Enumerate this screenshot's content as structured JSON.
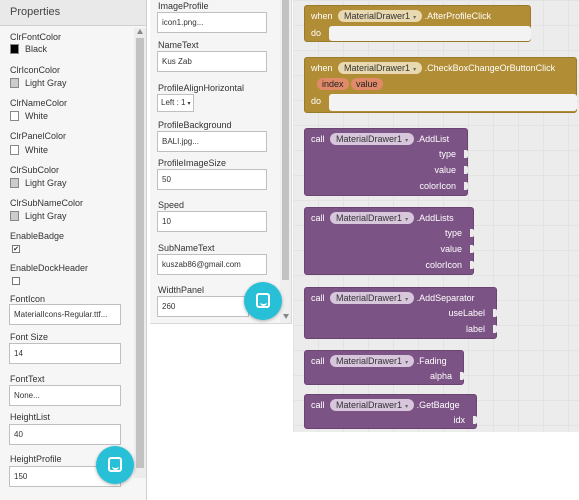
{
  "left_panel": {
    "title": "Properties",
    "props": {
      "clr_font_color_label": "ClrFontColor",
      "clr_font_color_value": "Black",
      "clr_icon_color_label": "ClrIconColor",
      "clr_icon_color_value": "Light Gray",
      "clr_name_color_label": "ClrNameColor",
      "clr_name_color_value": "White",
      "clr_panel_color_label": "ClrPanelColor",
      "clr_panel_color_value": "White",
      "clr_sub_color_label": "ClrSubColor",
      "clr_sub_color_value": "Light Gray",
      "clr_sub_name_color_label": "ClrSubNameColor",
      "clr_sub_name_color_value": "Light Gray",
      "enable_badge_label": "EnableBadge",
      "enable_badge_checked": "✔",
      "enable_dock_header_label": "EnableDockHeader",
      "font_icon_label": "FontIcon",
      "font_icon_value": "MaterialIcons-Regular.ttf...",
      "font_size_label": "Font Size",
      "font_size_value": "14",
      "font_text_label": "FontText",
      "font_text_value": "None...",
      "height_list_label": "HeightList",
      "height_list_value": "40",
      "height_profile_label": "HeightProfile",
      "height_profile_value": "150"
    },
    "swatch_colors": {
      "black": "#000000",
      "light_gray": "#cccccc",
      "white": "#ffffff"
    }
  },
  "middle_panel": {
    "image_profile_label": "ImageProfile",
    "image_profile_value": "icon1.png...",
    "name_text_label": "NameText",
    "name_text_value": "Kus Zab",
    "profile_align_label": "ProfileAlignHorizontal",
    "profile_align_value": "Left : 1",
    "profile_bg_label": "ProfileBackground",
    "profile_bg_value": "BALI.jpg...",
    "profile_image_size_label": "ProfileImageSize",
    "profile_image_size_value": "50",
    "speed_label": "Speed",
    "speed_value": "10",
    "sub_name_text_label": "SubNameText",
    "sub_name_text_value": "kuszab86@gmail.com",
    "width_panel_label": "WidthPanel",
    "width_panel_value": "260"
  },
  "blocks": {
    "component": "MaterialDrawer1",
    "b1": {
      "when": "when",
      "event": ".AfterProfileClick",
      "do": "do"
    },
    "b2": {
      "when": "when",
      "event": ".CheckBoxChangeOrButtonClick",
      "param1": "index",
      "param2": "value",
      "do": "do"
    },
    "b3": {
      "call": "call",
      "method": ".AddList",
      "args": [
        "type",
        "value",
        "colorIcon"
      ]
    },
    "b4": {
      "call": "call",
      "method": ".AddLists",
      "args": [
        "type",
        "value",
        "colorIcon"
      ]
    },
    "b5": {
      "call": "call",
      "method": ".AddSeparator",
      "args": [
        "useLabel",
        "label"
      ]
    },
    "b6": {
      "call": "call",
      "method": ".Fading",
      "args": [
        "alpha"
      ]
    },
    "b7": {
      "call": "call",
      "method": ".GetBadge",
      "args": [
        "idx"
      ]
    }
  },
  "colors": {
    "event_block": "#b18e35",
    "method_block": "#7c5385",
    "fab": "#27c0d6"
  }
}
